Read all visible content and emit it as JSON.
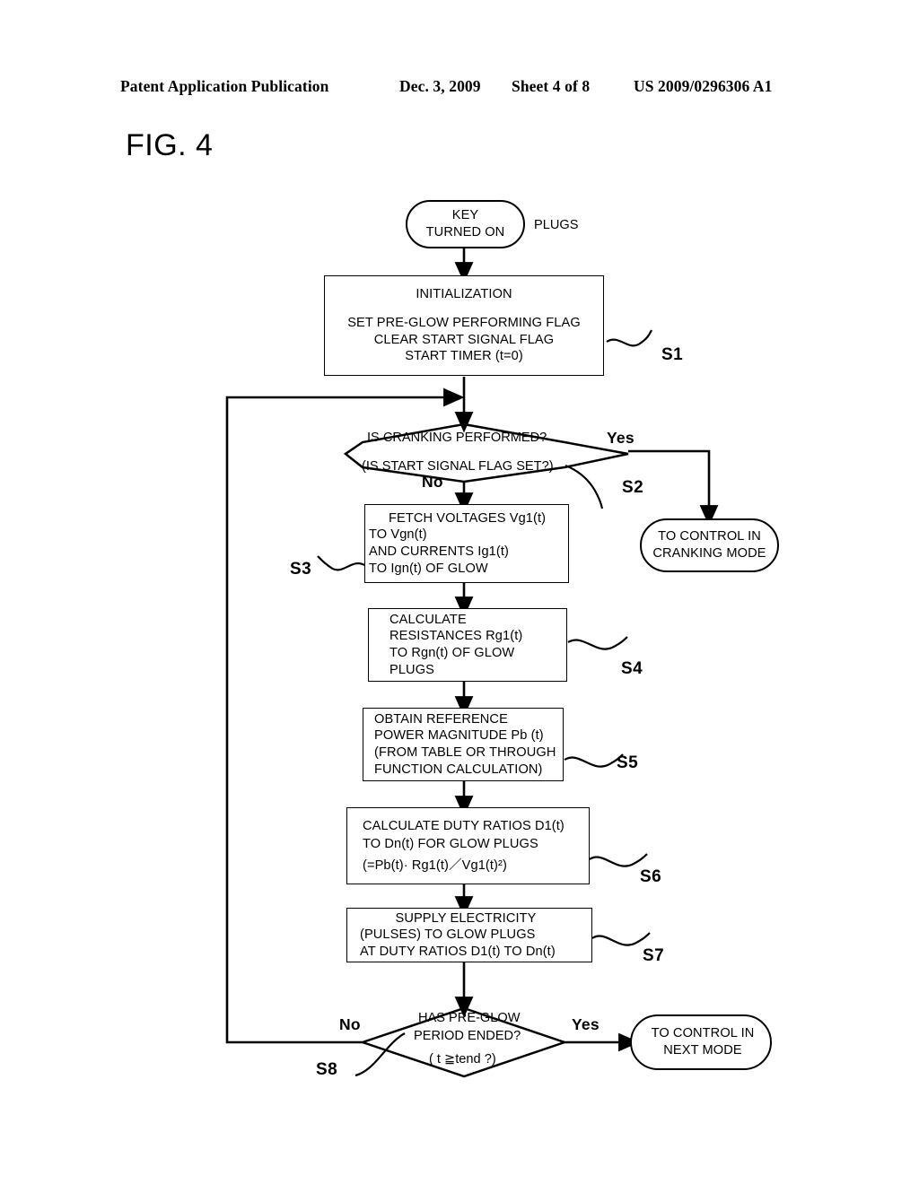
{
  "header": {
    "publication": "Patent Application Publication",
    "date": "Dec. 3, 2009",
    "sheet": "Sheet 4 of 8",
    "patent_number": "US 2009/0296306 A1"
  },
  "figure": {
    "label": "FIG. 4"
  },
  "flowchart": {
    "start": {
      "line1": "KEY",
      "line2": "TURNED ON",
      "side_label": "PLUGS"
    },
    "s1": {
      "tag": "S1",
      "line1": "INITIALIZATION",
      "line2": "SET PRE-GLOW  PERFORMING FLAG",
      "line3": "CLEAR START SIGNAL FLAG",
      "line4": "START TIMER (t=0)"
    },
    "s2": {
      "tag": "S2",
      "line1": "IS CRANKING PERFORMED?",
      "line2": "(IS START SIGNAL FLAG SET?)",
      "yes": "Yes",
      "no": "No"
    },
    "s3": {
      "tag": "S3",
      "line1": "FETCH VOLTAGES Vg1(t)",
      "line2": "TO Vgn(t)",
      "line3": "AND  CURRENTS Ig1(t)",
      "line4": "TO Ign(t) OF GLOW"
    },
    "cranking_mode": {
      "line1": "TO CONTROL IN",
      "line2": "CRANKING MODE"
    },
    "s4": {
      "tag": "S4",
      "line1": "CALCULATE",
      "line2": "RESISTANCES Rg1(t)",
      "line3": "TO Rgn(t) OF GLOW",
      "line4": "PLUGS"
    },
    "s5": {
      "tag": "S5",
      "line1": "OBTAIN REFERENCE",
      "line2": "POWER MAGNITUDE Pb (t)",
      "line3": "(FROM TABLE OR THROUGH",
      "line4": " FUNCTION CALCULATION)"
    },
    "s6": {
      "tag": "S6",
      "line1": "CALCULATE DUTY  RATIOS D1(t)",
      "line2": "TO Dn(t)  FOR GLOW PLUGS",
      "line3": " (=Pb(t)· Rg1(t)／Vg1(t)²)"
    },
    "s7": {
      "tag": "S7",
      "line1": "SUPPLY ELECTRICITY",
      "line2": "(PULSES) TO GLOW PLUGS",
      "line3": "AT DUTY RATIOS D1(t) TO Dn(t)"
    },
    "s8": {
      "tag": "S8",
      "line1": "HAS PRE-GLOW",
      "line2": "PERIOD ENDED?",
      "line3": "( t ≧tend ?)",
      "yes": "Yes",
      "no": "No"
    },
    "next_mode": {
      "line1": "TO CONTROL IN",
      "line2": "NEXT MODE"
    }
  },
  "colors": {
    "ink": "#000000",
    "paper": "#ffffff"
  }
}
